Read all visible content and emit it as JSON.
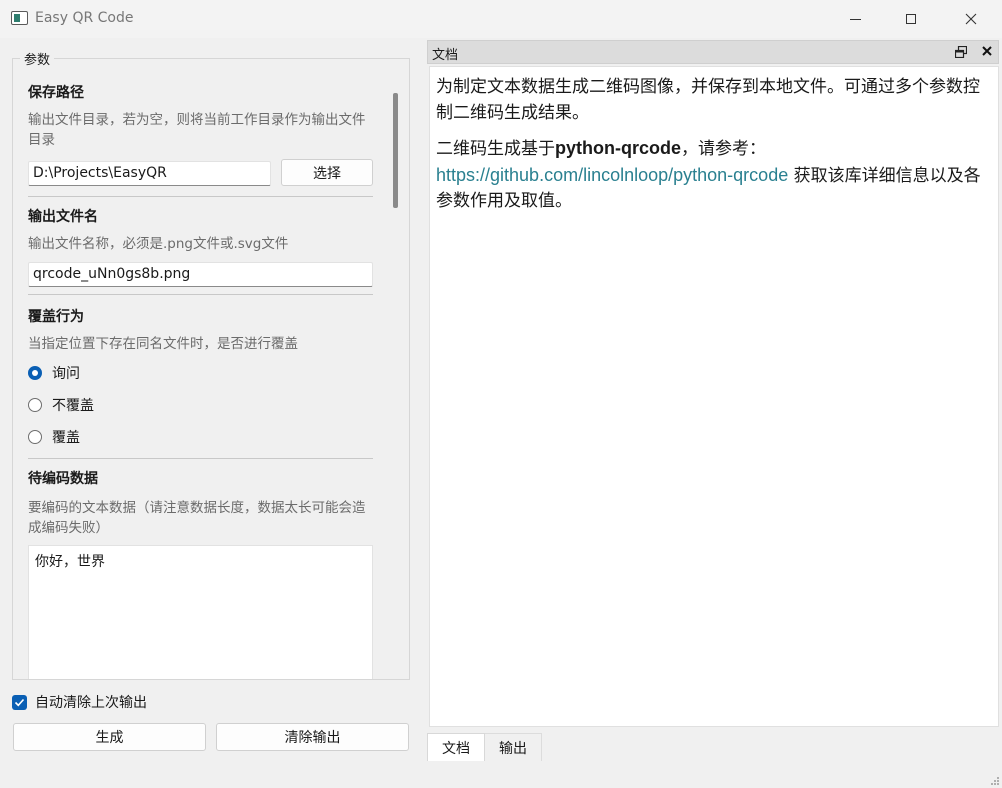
{
  "window": {
    "title": "Easy QR Code"
  },
  "params": {
    "group_title": "参数",
    "save_path": {
      "title": "保存路径",
      "desc": "输出文件目录，若为空，则将当前工作目录作为输出文件目录",
      "value": "D:\\Projects\\EasyQR",
      "button": "选择"
    },
    "output_name": {
      "title": "输出文件名",
      "desc": "输出文件名称，必须是.png文件或.svg文件",
      "value": "qrcode_uNn0gs8b.png"
    },
    "overwrite": {
      "title": "覆盖行为",
      "desc": "当指定位置下存在同名文件时，是否进行覆盖",
      "options": [
        "询问",
        "不覆盖",
        "覆盖"
      ],
      "selected": "询问"
    },
    "data": {
      "title": "待编码数据",
      "desc": "要编码的文本数据（请注意数据长度，数据太长可能会造成编码失败）",
      "value": "你好，世界"
    }
  },
  "bottom": {
    "auto_clear_label": "自动清除上次输出",
    "auto_clear_checked": true,
    "generate_button": "生成",
    "clear_button": "清除输出"
  },
  "dock": {
    "title": "文档",
    "paragraph1": "为制定文本数据生成二维码图像，并保存到本地文件。可通过多个参数控制二维码生成结果。",
    "p2_prefix": "二维码生成基于",
    "p2_bold": "python-qrcode",
    "p2_mid": "，请参考： ",
    "p2_link": "https://github.com/lincolnloop/python-qrcode",
    "p2_suffix": " 获取该库详细信息以及各参数作用及取值。",
    "tabs": [
      "文档",
      "输出"
    ],
    "active_tab": "文档"
  },
  "colors": {
    "accent": "#0a5fb4",
    "link": "#2a8090"
  }
}
